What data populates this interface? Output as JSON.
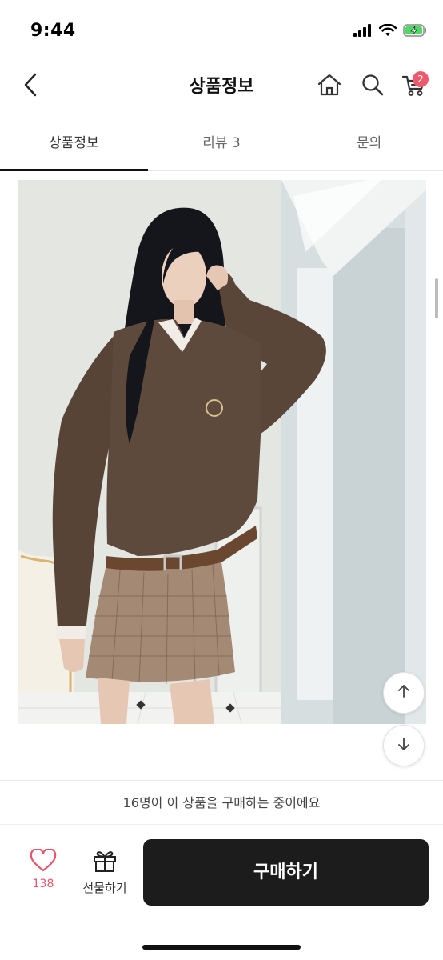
{
  "status": {
    "time": "9:44"
  },
  "header": {
    "title": "상품정보",
    "cart_count": "2",
    "icons": [
      "back-chevron-icon",
      "home-icon",
      "search-icon",
      "cart-icon"
    ]
  },
  "tabs": [
    {
      "label": "상품정보",
      "active": true
    },
    {
      "label": "리뷰 3",
      "active": false
    },
    {
      "label": "문의",
      "active": false
    }
  ],
  "viewer_notice": "16명이 이 상품을 구매하는 중이에요",
  "bottom": {
    "like_count": "138",
    "gift_label": "선물하기",
    "buy_label": "구매하기"
  },
  "colors": {
    "accent_pink": "#e8556a",
    "badge_red": "#ef5a6b",
    "buy_button_bg": "#1c1c1c"
  }
}
